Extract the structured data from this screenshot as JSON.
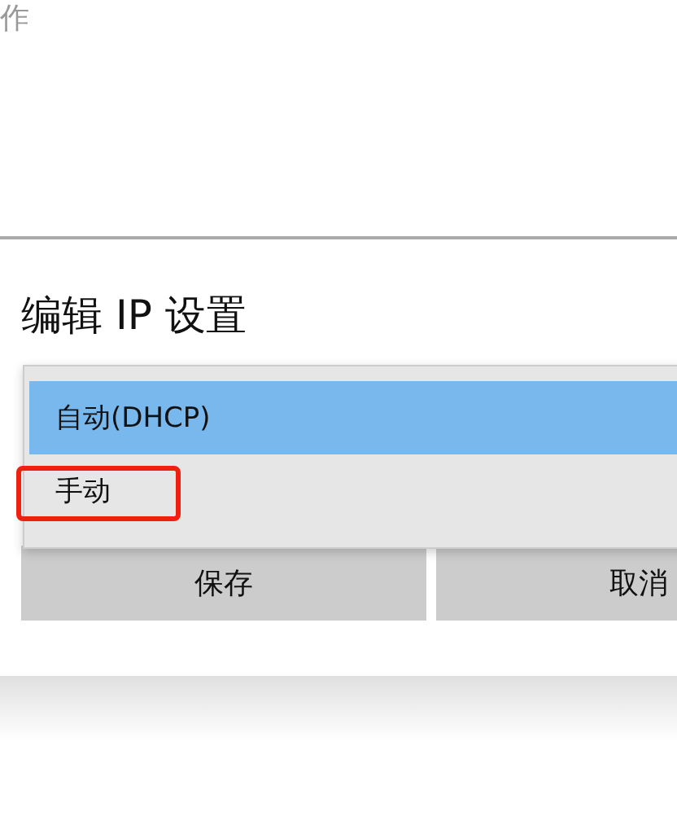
{
  "background": {
    "partial_text": "作"
  },
  "dialog": {
    "title": "编辑 IP 设置",
    "dropdown": {
      "options": [
        {
          "label": "自动(DHCP)",
          "selected": true,
          "highlighted": false
        },
        {
          "label": "手动",
          "selected": false,
          "highlighted": true
        }
      ]
    },
    "buttons": [
      {
        "label": "保存"
      },
      {
        "label": "取消"
      }
    ]
  }
}
